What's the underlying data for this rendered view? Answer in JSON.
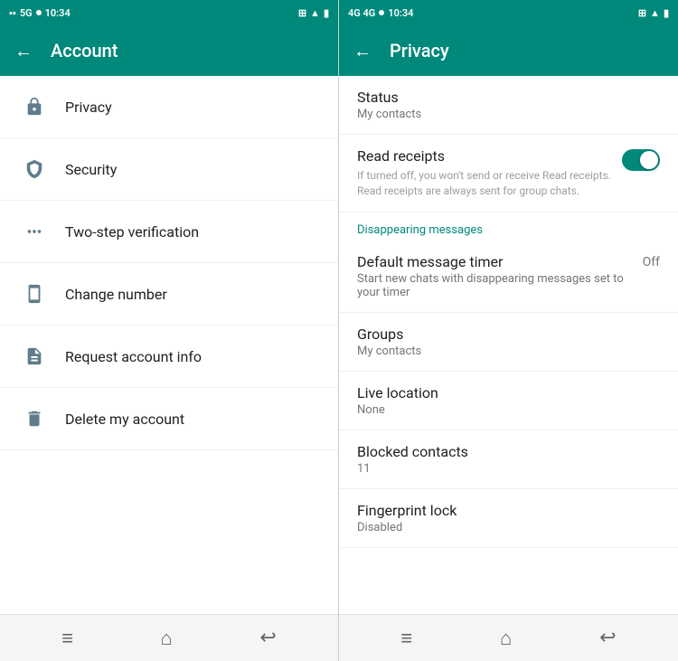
{
  "left_phone": {
    "status_bar": {
      "time": "10:34",
      "dot": true,
      "network": "5G",
      "wifi": "wifi",
      "battery": "100"
    },
    "header": {
      "back_label": "←",
      "title": "Account"
    },
    "menu_items": [
      {
        "id": "privacy",
        "label": "Privacy",
        "icon": "lock"
      },
      {
        "id": "security",
        "label": "Security",
        "icon": "shield"
      },
      {
        "id": "two-step",
        "label": "Two-step verification",
        "icon": "dots"
      },
      {
        "id": "change-number",
        "label": "Change number",
        "icon": "phone"
      },
      {
        "id": "request-account",
        "label": "Request account info",
        "icon": "file"
      },
      {
        "id": "delete-account",
        "label": "Delete my account",
        "icon": "trash"
      }
    ],
    "bottom_nav": {
      "menu_icon": "≡",
      "home_icon": "⌂",
      "back_icon": "↩"
    }
  },
  "right_phone": {
    "status_bar": {
      "time": "10:34",
      "dot": true,
      "network": "4G",
      "wifi": "wifi",
      "battery": "100"
    },
    "header": {
      "back_label": "←",
      "title": "Privacy"
    },
    "items": [
      {
        "id": "status",
        "title": "Status",
        "subtitle": "My contacts",
        "type": "link"
      },
      {
        "id": "read-receipts",
        "title": "Read receipts",
        "description": "If turned off, you won't send or receive Read receipts. Read receipts are always sent for group chats.",
        "type": "toggle",
        "toggle_on": true
      },
      {
        "id": "disappearing-section",
        "type": "section",
        "label": "Disappearing messages"
      },
      {
        "id": "default-message-timer",
        "title": "Default message timer",
        "subtitle": "Start new chats with disappearing messages set to your timer",
        "value": "Off",
        "type": "value"
      },
      {
        "id": "groups",
        "title": "Groups",
        "subtitle": "My contacts",
        "type": "link"
      },
      {
        "id": "live-location",
        "title": "Live location",
        "subtitle": "None",
        "type": "link"
      },
      {
        "id": "blocked-contacts",
        "title": "Blocked contacts",
        "subtitle": "11",
        "type": "link"
      },
      {
        "id": "fingerprint-lock",
        "title": "Fingerprint lock",
        "subtitle": "Disabled",
        "type": "link"
      }
    ],
    "bottom_nav": {
      "menu_icon": "≡",
      "home_icon": "⌂",
      "back_icon": "↩"
    }
  }
}
